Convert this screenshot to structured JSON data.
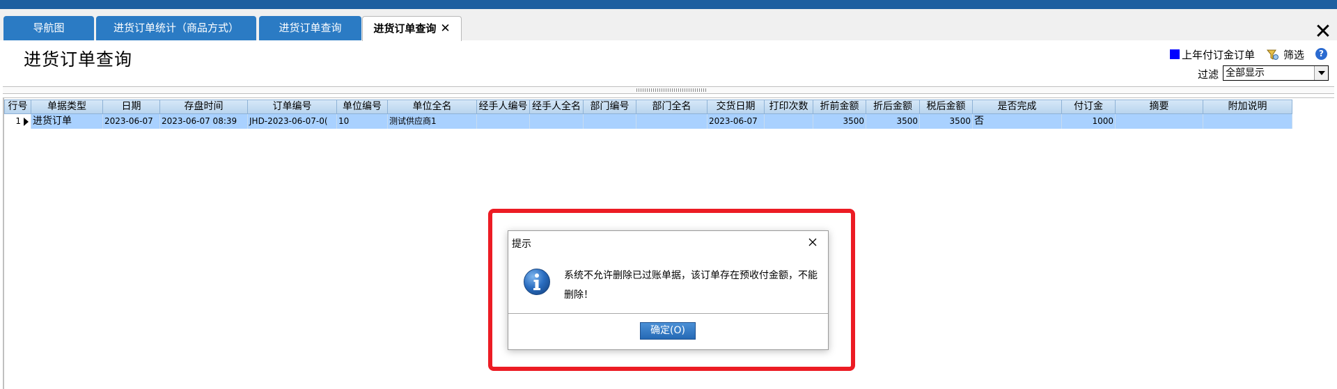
{
  "tabs": [
    {
      "label": "导航图"
    },
    {
      "label": "进货订单统计（商品方式）"
    },
    {
      "label": "进货订单查询"
    },
    {
      "label": "进货订单查询",
      "close": "✕"
    }
  ],
  "window": {
    "close": "✕"
  },
  "page": {
    "title": "进货订单查询"
  },
  "toolbar": {
    "legend_label": "上年付订金订单",
    "legend_color": "#0000ff",
    "filter_button": "筛选",
    "help": "?",
    "filter_label": "过滤",
    "filter_value": "全部显示"
  },
  "grid": {
    "columns": [
      "行号",
      "单据类型",
      "日期",
      "存盘时间",
      "订单编号",
      "单位编号",
      "单位全名",
      "经手人编号",
      "经手人全名",
      "部门编号",
      "部门全名",
      "交货日期",
      "打印次数",
      "折前金额",
      "折后金额",
      "税后金额",
      "是否完成",
      "付订金",
      "摘要",
      "附加说明"
    ],
    "rows": [
      {
        "row_no": "1",
        "type": "进货订单",
        "date": "2023-06-07",
        "saved_time": "2023-06-07 08:39",
        "order_no": "JHD-2023-06-07-0(",
        "unit_code": "10",
        "unit_name": "测试供应商1",
        "handler_code": "",
        "handler_name": "",
        "dept_code": "",
        "dept_name": "",
        "delivery_date": "2023-06-07",
        "print_count": "",
        "amount_before": "3500",
        "amount_after": "3500",
        "amount_tax": "3500",
        "completed": "否",
        "deposit": "1000",
        "summary": "",
        "note": ""
      }
    ]
  },
  "dialog": {
    "title": "提示",
    "message": "系统不允许删除已过账单据，该订单存在预收付金额，不能删除！",
    "ok_button": "确定(O)",
    "icon": "info-icon"
  }
}
